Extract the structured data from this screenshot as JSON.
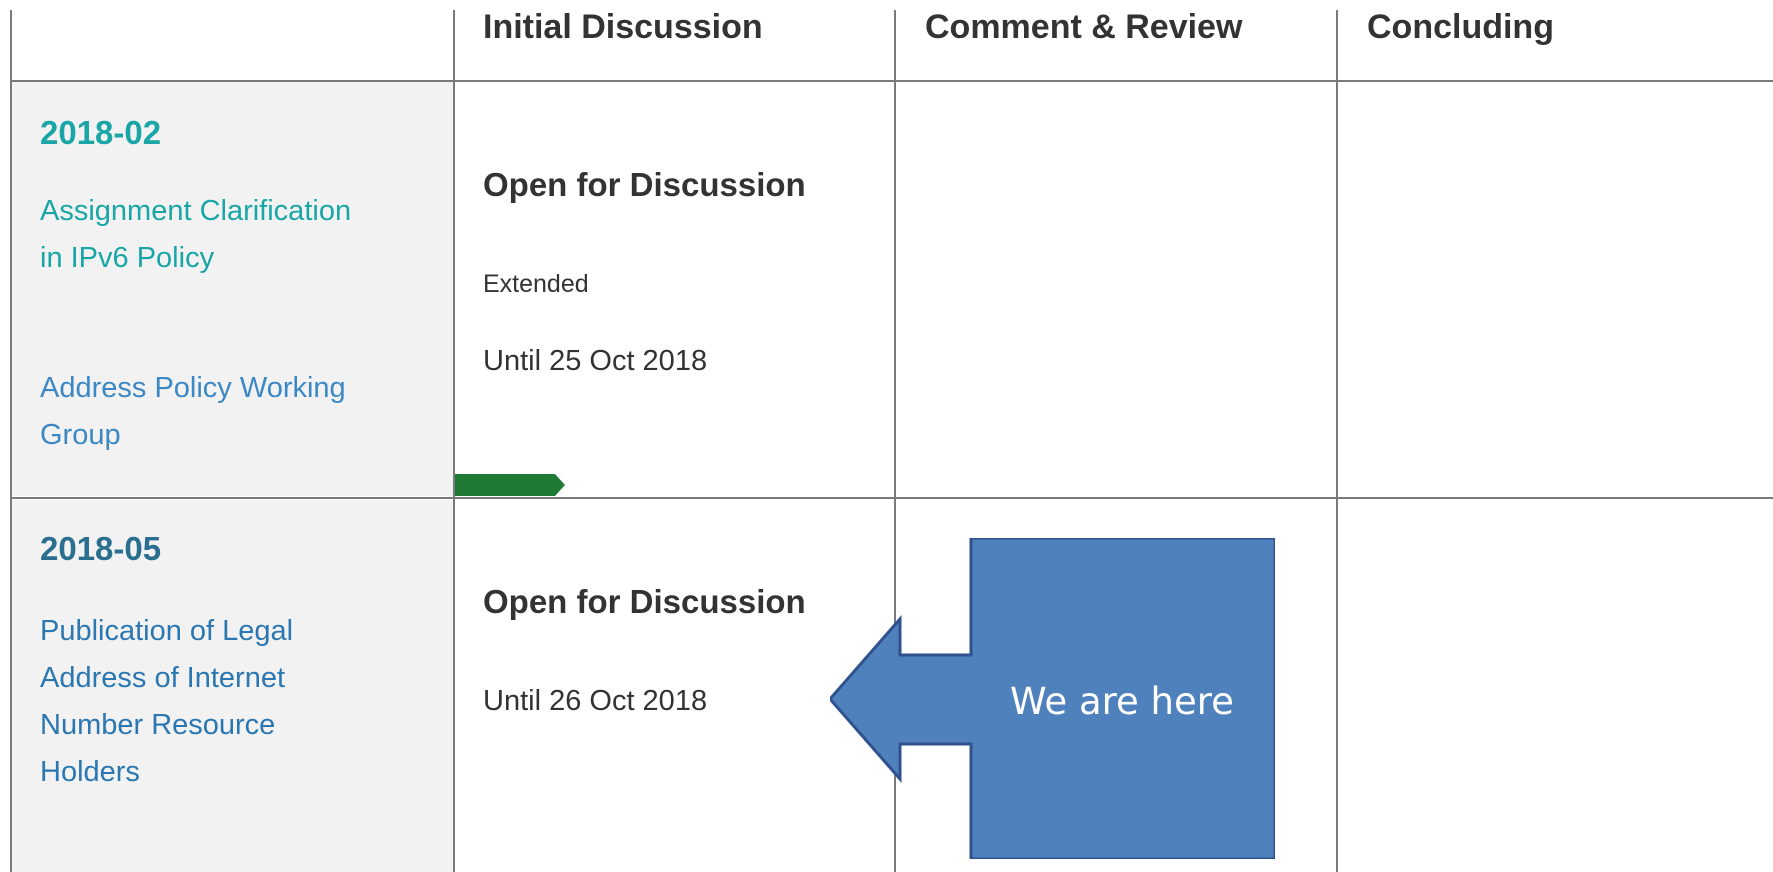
{
  "colors": {
    "grid": "#7a7a7a",
    "left_bg": "#f2f2f2",
    "teal": "#1aa6a6",
    "link_blue": "#3b88c4",
    "progress_green": "#1f7a35",
    "callout_fill": "#4f81bd",
    "callout_border": "#2f528f"
  },
  "columns": [
    "Initial Discussion",
    "Comment & Review",
    "Concluding"
  ],
  "rows": [
    {
      "id": "2018-02",
      "title_lines": [
        "Assignment Clarification",
        "in IPv6 Policy"
      ],
      "group_lines": [
        "Address Policy Working",
        "Group"
      ],
      "status": "Open for Discussion",
      "note": "Extended",
      "until": "Until 25 Oct 2018",
      "progress": 0.33
    },
    {
      "id": "2018-05",
      "title_lines": [
        "Publication of Legal",
        "Address of Internet",
        "Number Resource",
        "Holders"
      ],
      "status": "Open for Discussion",
      "until": "Until 26 Oct 2018"
    }
  ],
  "callout": {
    "text": "We are here"
  }
}
